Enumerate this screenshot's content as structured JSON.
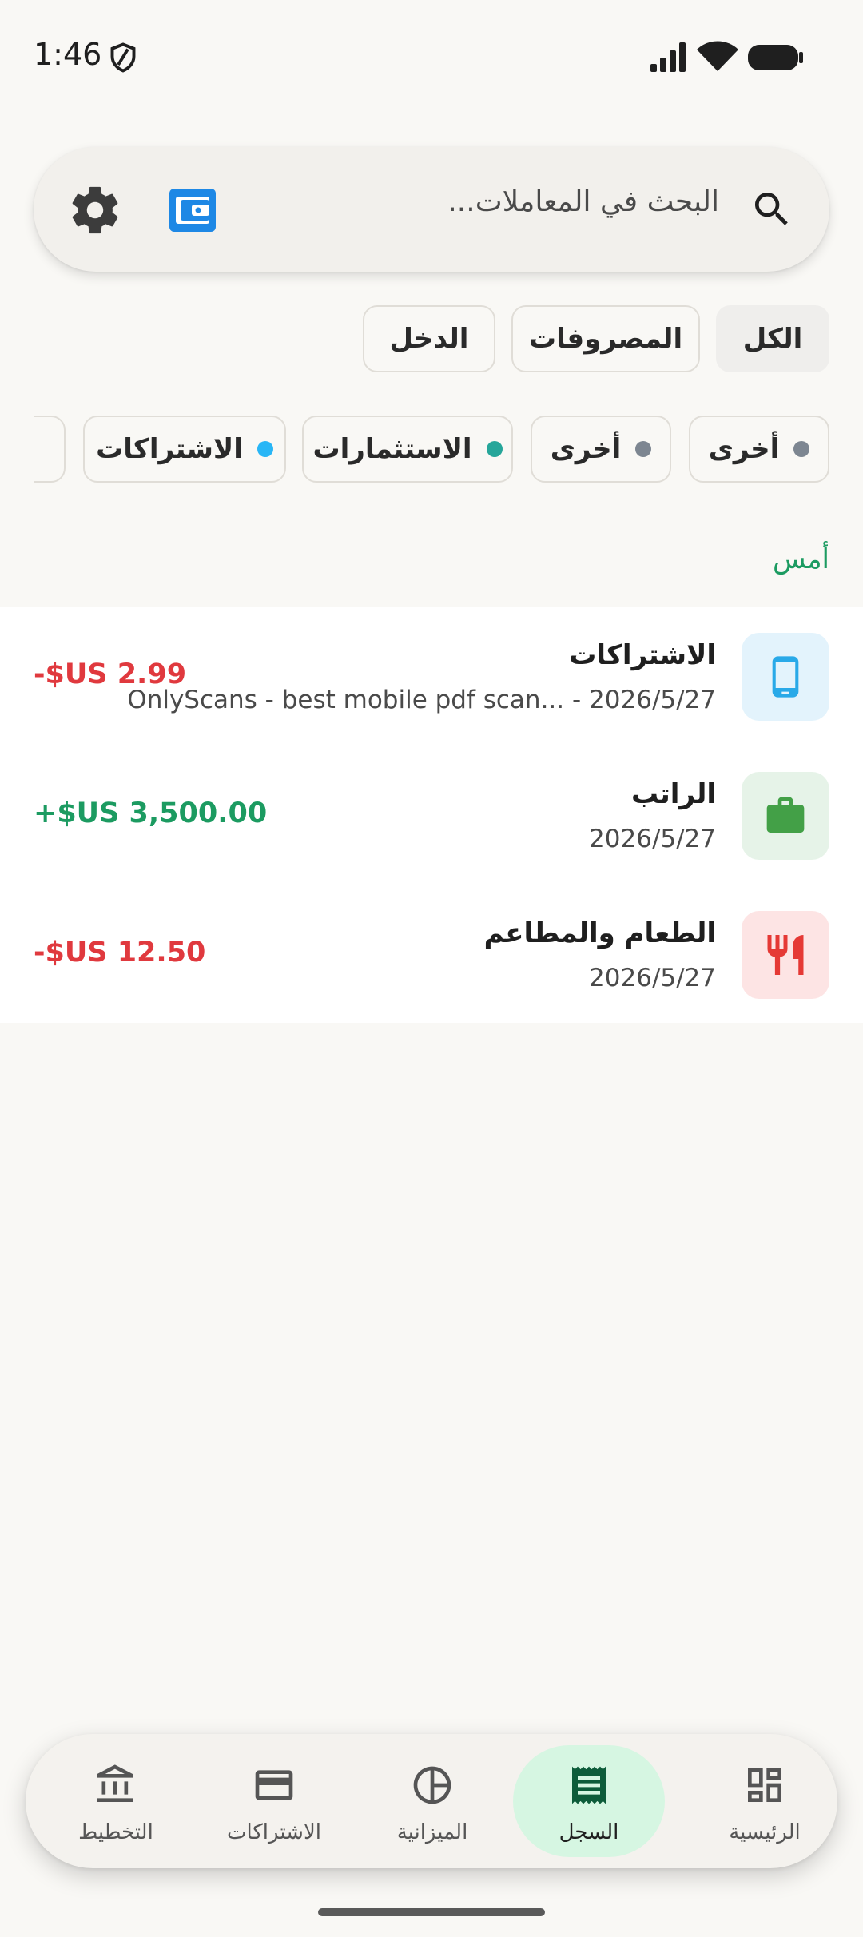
{
  "status": {
    "time": "1:46"
  },
  "search": {
    "placeholder": "البحث في المعاملات..."
  },
  "filters": [
    {
      "label": "الكل",
      "active": true
    },
    {
      "label": "المصروفات",
      "active": false
    },
    {
      "label": "الدخل",
      "active": false
    }
  ],
  "chips": [
    {
      "label": "أخرى",
      "color": "#7d8691"
    },
    {
      "label": "أخرى",
      "color": "#7d8691"
    },
    {
      "label": "الاستثمارات",
      "color": "#26a69a"
    },
    {
      "label": "الاشتراكات",
      "color": "#29b6f6"
    },
    {
      "label": "",
      "color": "#43a047"
    }
  ],
  "section": {
    "title": "أمس"
  },
  "transactions": [
    {
      "title": "الاشتراكات",
      "date": "2026/5/27",
      "note": "OnlyScans - best mobile pdf scan... -",
      "amount": "-$US 2.99",
      "type": "expense",
      "icon": "smartphone-icon",
      "icon_bg": "#e3f3fc",
      "icon_color": "#29a9e8"
    },
    {
      "title": "الراتب",
      "date": "2026/5/27",
      "note": "",
      "amount": "+$US 3,500.00",
      "type": "income",
      "icon": "briefcase-icon",
      "icon_bg": "#e6f3e8",
      "icon_color": "#43a047"
    },
    {
      "title": "الطعام والمطاعم",
      "date": "2026/5/27",
      "note": "",
      "amount": "-$US 12.50",
      "type": "expense",
      "icon": "restaurant-icon",
      "icon_bg": "#fde4e4",
      "icon_color": "#e53935"
    }
  ],
  "nav": [
    {
      "label": "الرئيسية",
      "icon": "dashboard-icon",
      "active": false
    },
    {
      "label": "السجل",
      "icon": "receipt-icon",
      "active": true
    },
    {
      "label": "الميزانية",
      "icon": "pie-chart-icon",
      "active": false
    },
    {
      "label": "الاشتراكات",
      "icon": "credit-card-icon",
      "active": false
    },
    {
      "label": "التخطيط",
      "icon": "bank-icon",
      "active": false
    }
  ],
  "colors": {
    "accent_green": "#1c9b61",
    "expense_red": "#e0393e",
    "wallet_blue": "#1e88e5"
  }
}
